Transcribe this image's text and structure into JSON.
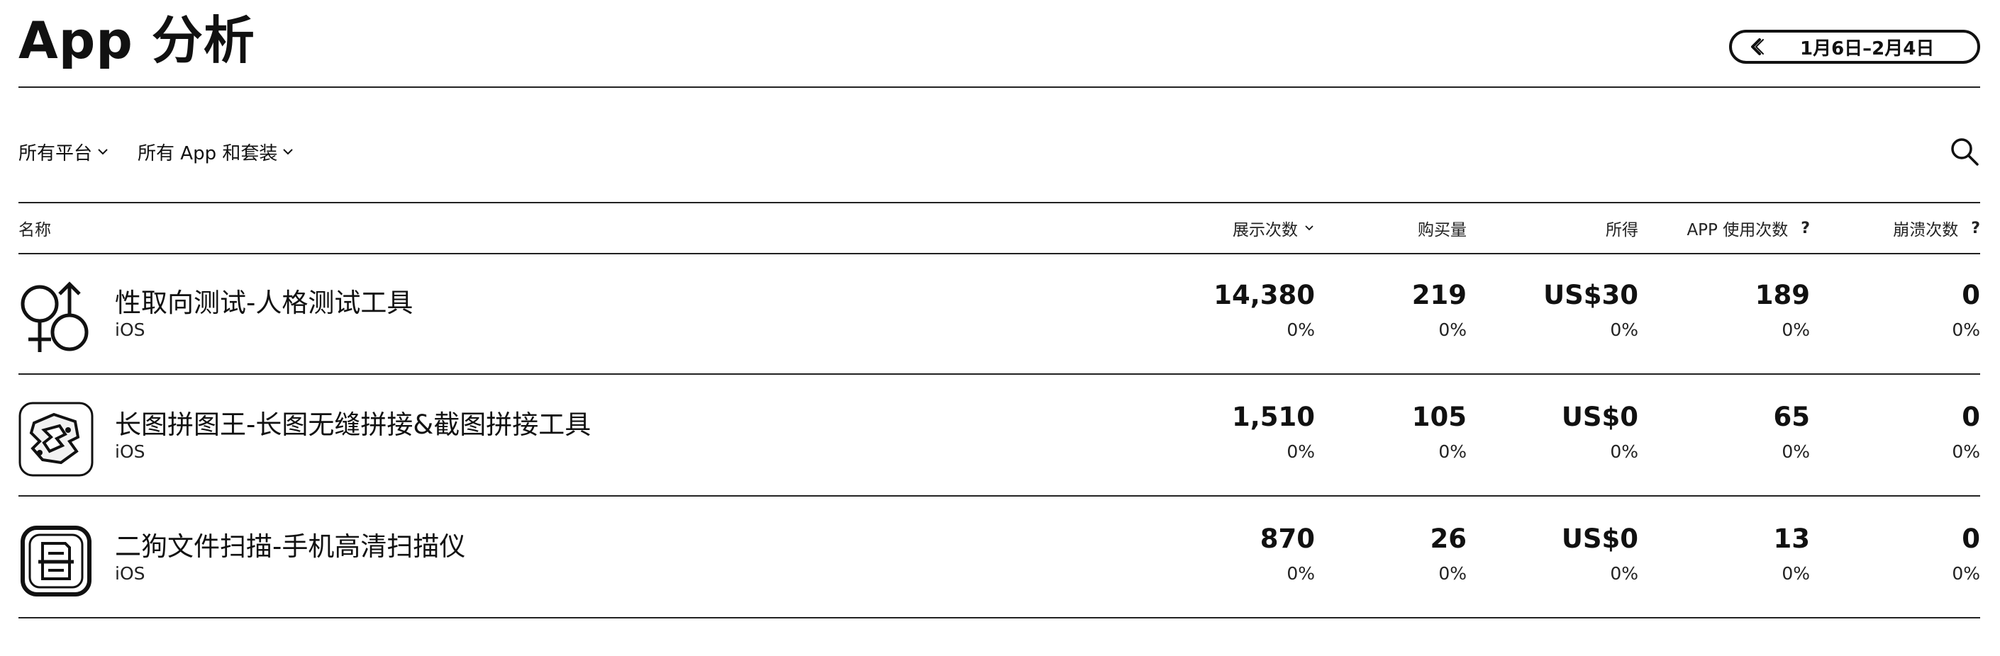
{
  "page": {
    "title": "App 分析",
    "date_range": "1月6日–2月4日"
  },
  "filters": [
    {
      "label": "所有平台"
    },
    {
      "label": "所有 App 和套装"
    }
  ],
  "table": {
    "columns": {
      "name": "名称",
      "impressions": "展示次数",
      "purchases": "购买量",
      "proceeds": "所得",
      "sessions": "APP 使用次数",
      "sessions_help": "?",
      "crashes": "崩溃次数",
      "crashes_help": "?"
    },
    "rows": [
      {
        "icon": "gender-symbols-icon",
        "name": "性取向测试-人格测试工具",
        "platform": "iOS",
        "impressions": "14,380",
        "impressions_pct": "0%",
        "purchases": "219",
        "purchases_pct": "0%",
        "proceeds": "US$30",
        "proceeds_pct": "0%",
        "sessions": "189",
        "sessions_pct": "0%",
        "crashes": "0",
        "crashes_pct": "0%"
      },
      {
        "icon": "puzzle-app-icon",
        "name": "长图拼图王-长图无缝拼接&截图拼接工具",
        "platform": "iOS",
        "impressions": "1,510",
        "impressions_pct": "0%",
        "purchases": "105",
        "purchases_pct": "0%",
        "proceeds": "US$0",
        "proceeds_pct": "0%",
        "sessions": "65",
        "sessions_pct": "0%",
        "crashes": "0",
        "crashes_pct": "0%"
      },
      {
        "icon": "document-scanner-app-icon",
        "name": "二狗文件扫描-手机高清扫描仪",
        "platform": "iOS",
        "impressions": "870",
        "impressions_pct": "0%",
        "purchases": "26",
        "purchases_pct": "0%",
        "proceeds": "US$0",
        "proceeds_pct": "0%",
        "sessions": "13",
        "sessions_pct": "0%",
        "crashes": "0",
        "crashes_pct": "0%"
      }
    ]
  }
}
